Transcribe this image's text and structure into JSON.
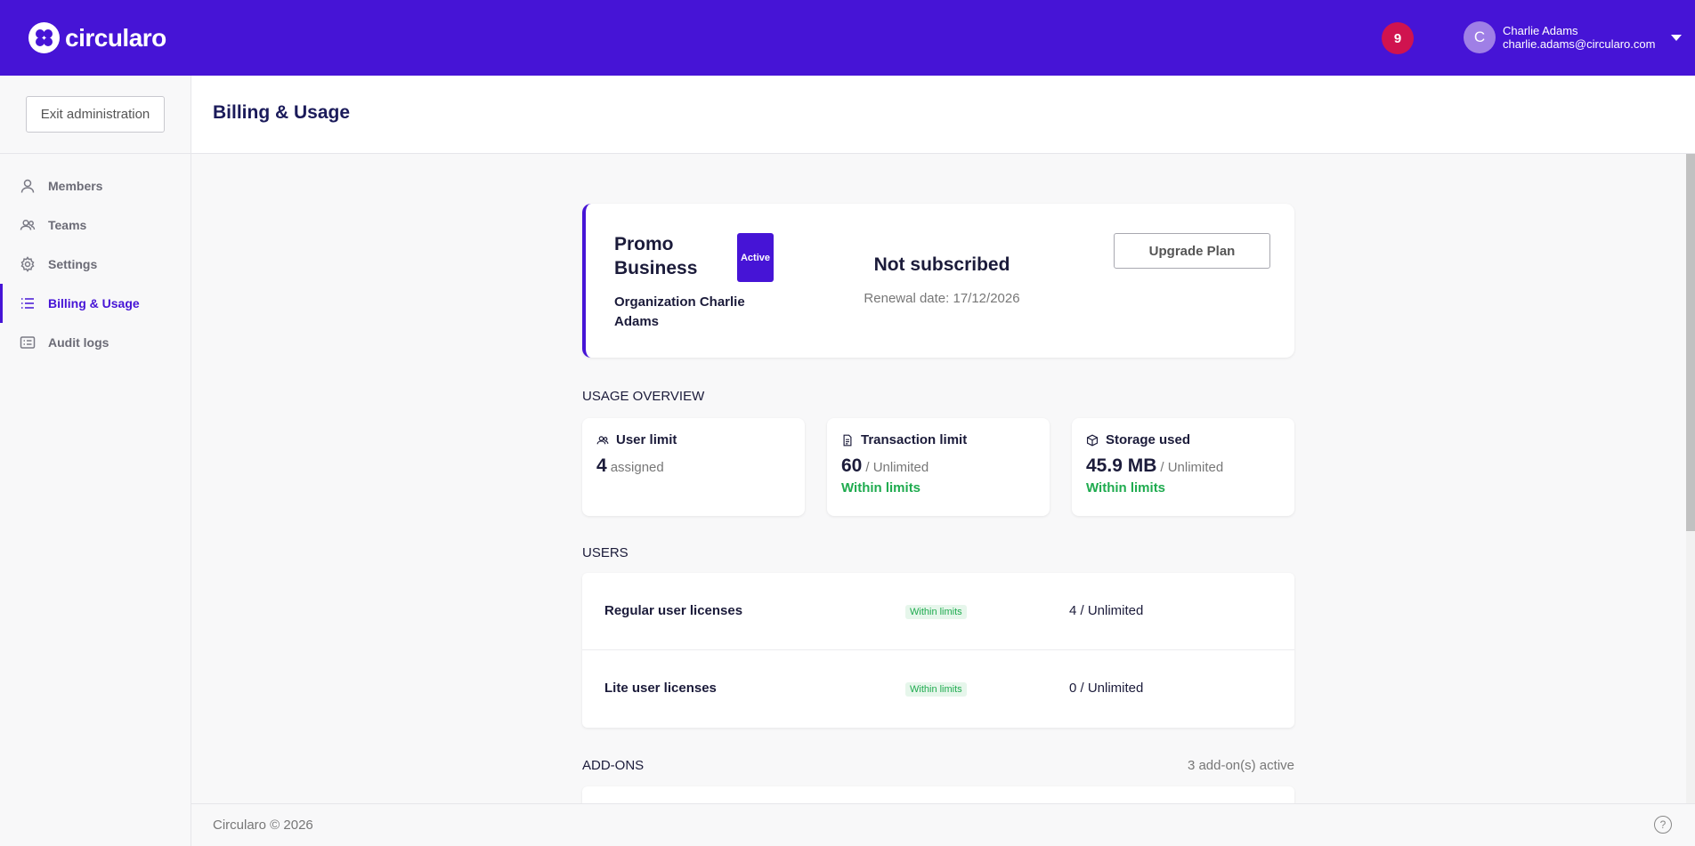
{
  "header": {
    "brand": "circularo",
    "notifications_count": "9",
    "user": {
      "initial": "C",
      "name": "Charlie Adams",
      "email": "charlie.adams@circularo.com"
    }
  },
  "sidebar": {
    "exit_label": "Exit administration",
    "items": [
      {
        "label": "Members",
        "icon": "user-icon"
      },
      {
        "label": "Teams",
        "icon": "users-icon"
      },
      {
        "label": "Settings",
        "icon": "gear-icon"
      },
      {
        "label": "Billing & Usage",
        "icon": "list-icon",
        "active": true
      },
      {
        "label": "Audit logs",
        "icon": "log-icon"
      }
    ]
  },
  "page": {
    "title": "Billing & Usage"
  },
  "plan": {
    "name": "Promo Business",
    "status_badge": "Active",
    "organization": "Organization Charlie Adams",
    "subscription_status": "Not subscribed",
    "renewal": "Renewal date: 17/12/2026",
    "upgrade_label": "Upgrade Plan"
  },
  "usage": {
    "section_label": "USAGE OVERVIEW",
    "cards": [
      {
        "title": "User limit",
        "icon": "users-icon",
        "value": "4",
        "suffix": "assigned",
        "status": ""
      },
      {
        "title": "Transaction limit",
        "icon": "document-icon",
        "value": "60",
        "suffix": "/ Unlimited",
        "status": "Within limits"
      },
      {
        "title": "Storage used",
        "icon": "box-icon",
        "value": "45.9 MB",
        "suffix": "/ Unlimited",
        "status": "Within limits"
      }
    ]
  },
  "users": {
    "section_label": "USERS",
    "rows": [
      {
        "name": "Regular user licenses",
        "status": "Within limits",
        "value": "4 / Unlimited"
      },
      {
        "name": "Lite user licenses",
        "status": "Within limits",
        "value": "0 / Unlimited"
      }
    ]
  },
  "addons": {
    "section_label": "ADD-ONS",
    "count_text": "3 add-on(s) active"
  },
  "footer": {
    "copyright": "Circularo © 2026",
    "help_glyph": "?"
  },
  "colors": {
    "brand": "#4614d6",
    "notification": "#d0134f",
    "ok": "#1fab4f"
  }
}
